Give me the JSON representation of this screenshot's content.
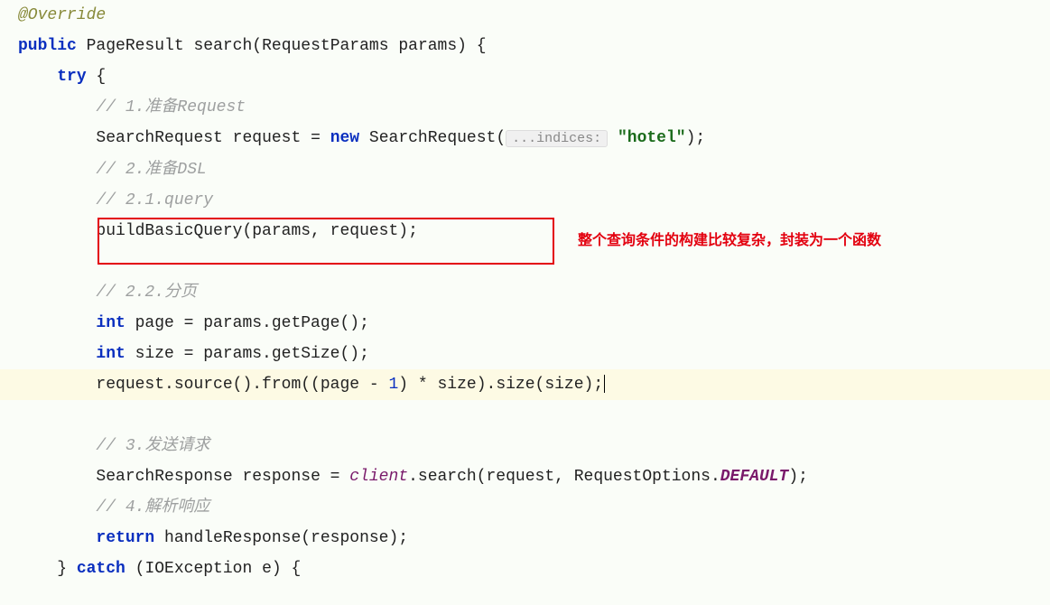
{
  "annotation": "@Override",
  "signature": {
    "modifier": "public",
    "returnType": "PageResult",
    "name": "search",
    "paramType": "RequestParams",
    "paramName": "params",
    "open": " {"
  },
  "tryLine": {
    "kw": "try",
    "open": " {"
  },
  "c1": "// 1.准备Request",
  "reqLine": {
    "type": "SearchRequest",
    "var": "request",
    "eq": " = ",
    "new": "new",
    "ctor": " SearchRequest(",
    "hint": "...indices:",
    "str": " \"hotel\"",
    "close": ");"
  },
  "c2": "// 2.准备DSL",
  "c21": "// 2.1.query",
  "buildLine": "buildBasicQuery(params, request);",
  "c22": "// 2.2.分页",
  "pageLine": {
    "kw": "int",
    "rest1": " page = params.getPage();"
  },
  "sizeLine": {
    "kw": "int",
    "rest1": " size = params.getSize();"
  },
  "fromLine": {
    "p1": "request.source().from((page - ",
    "num": "1",
    "p2": ") * size).size(size);"
  },
  "c3": "// 3.发送请求",
  "respLine": {
    "type": "SearchResponse",
    "var": " response = ",
    "field": "client",
    "call": ".search(request, RequestOptions.",
    "const": "DEFAULT",
    "close": ");"
  },
  "c4": "// 4.解析响应",
  "retLine": {
    "kw": "return",
    "rest": " handleResponse(response);"
  },
  "catchLine": {
    "close": "} ",
    "kw": "catch",
    "rest": " (IOException e) {"
  },
  "calloutText": "整个查询条件的构建比较复杂，封装为一个函数"
}
